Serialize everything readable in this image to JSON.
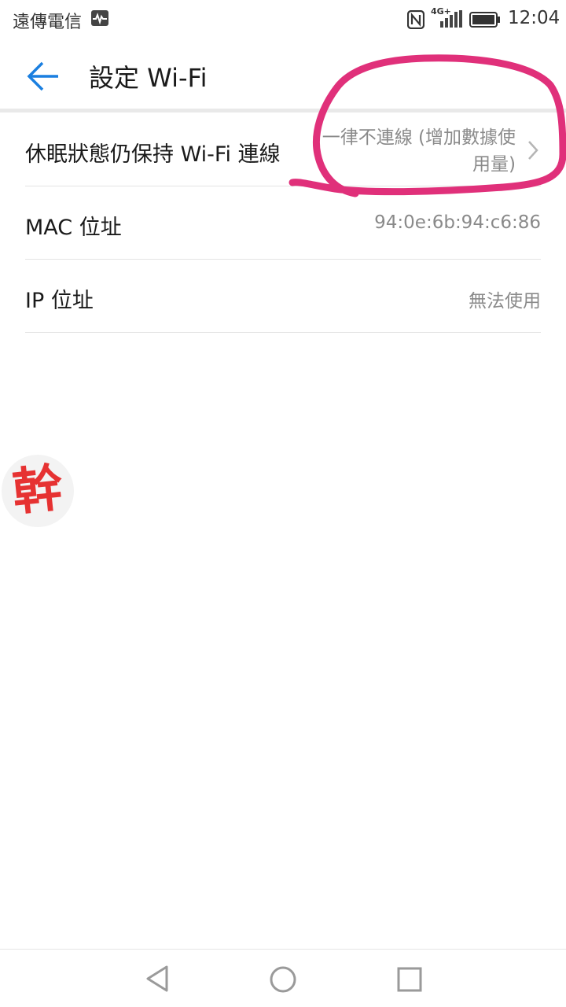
{
  "status_bar": {
    "carrier": "遠傳電信",
    "network": "4G+",
    "time": "12:04"
  },
  "header": {
    "title": "設定 Wi-Fi",
    "back_icon": "arrow-left-icon",
    "accent_color": "#1a7fe0"
  },
  "settings": [
    {
      "label": "休眠狀態仍保持 Wi-Fi 連線",
      "value": "一律不連線 (增加數據使用量)"
    },
    {
      "label": "MAC 位址",
      "value": "94:0e:6b:94:c6:86"
    },
    {
      "label": "IP 位址",
      "value": "無法使用"
    }
  ],
  "annotation": {
    "color": "#e0307a"
  },
  "stamp": {
    "text": "幹",
    "color": "#e63232"
  },
  "nav_bar": {
    "icons": [
      "triangle-back-icon",
      "circle-home-icon",
      "square-recents-icon"
    ]
  }
}
